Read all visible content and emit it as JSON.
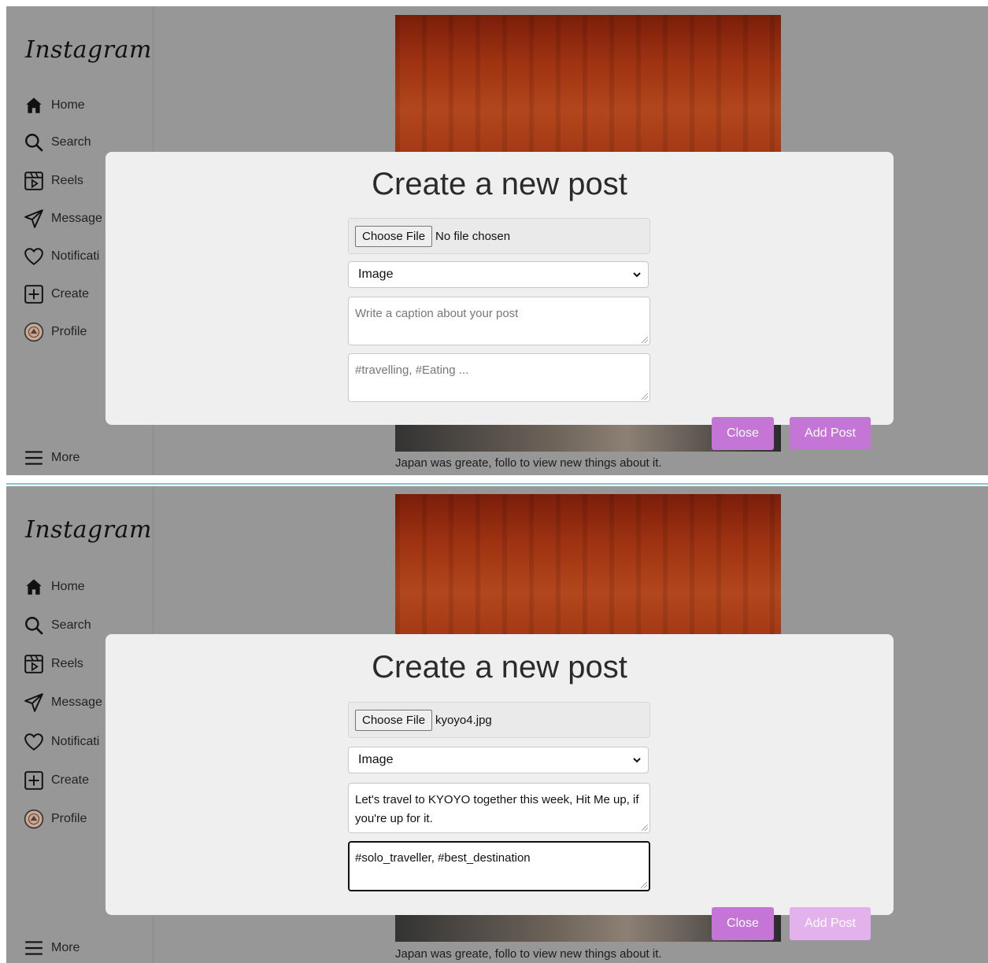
{
  "app": {
    "logo": "Instagram"
  },
  "sidebar": {
    "items": [
      {
        "label": "Home",
        "icon": "home-icon"
      },
      {
        "label": "Search",
        "icon": "search-icon"
      },
      {
        "label": "Reels",
        "icon": "reels-icon"
      },
      {
        "label": "Message",
        "icon": "send-icon"
      },
      {
        "label": "Notificati",
        "icon": "heart-icon"
      },
      {
        "label": "Create",
        "icon": "plus-square-icon"
      },
      {
        "label": "Profile",
        "icon": "avatar-icon"
      }
    ],
    "more_label": "More",
    "more_icon": "hamburger-icon"
  },
  "feed": {
    "post_caption": "Japan was greate, follo to view new things about it."
  },
  "modal_before": {
    "title": "Create a new post",
    "file_button": "Choose File",
    "file_status": "No file chosen",
    "type_value": "Image",
    "caption_placeholder": "Write a caption about your post",
    "tags_placeholder": "#travelling, #Eating ...",
    "close_label": "Close",
    "add_label": "Add Post"
  },
  "modal_after": {
    "title": "Create a new post",
    "file_button": "Choose File",
    "file_status": "kyoyo4.jpg",
    "type_value": "Image",
    "caption_value": "Let's travel to KYOYO together this week, Hit Me up, if you're up for it.",
    "tags_value": "#solo_traveller, #best_destination",
    "close_label": "Close",
    "add_label": "Add Post"
  },
  "colors": {
    "overlay": "#979797",
    "modal_bg": "#efefef",
    "button": "#c575d6",
    "button_disabled": "#e3b2ec",
    "divider": "#7fc9cc"
  }
}
